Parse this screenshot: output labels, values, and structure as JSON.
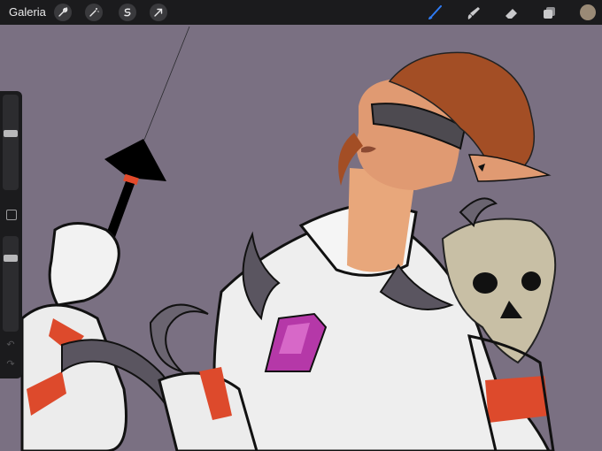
{
  "toolbar": {
    "gallery_label": "Galeria",
    "left_tools": [
      {
        "icon": "wrench-icon"
      },
      {
        "icon": "magic-wand-icon"
      },
      {
        "icon": "selection-icon"
      },
      {
        "icon": "transform-arrow-icon"
      }
    ],
    "right_tools": [
      {
        "icon": "brush-icon",
        "active": true
      },
      {
        "icon": "smudge-icon",
        "active": false
      },
      {
        "icon": "eraser-icon",
        "active": false
      },
      {
        "icon": "layers-icon",
        "active": false
      }
    ],
    "current_color": "#9a8a76"
  },
  "sidebar": {
    "brush_size_level": 0.6,
    "opacity_level": 0.8
  },
  "colors": {
    "canvas_background": "#7a7082",
    "toolbar_background": "#1b1b1d",
    "active_tool": "#2f7cf6"
  }
}
